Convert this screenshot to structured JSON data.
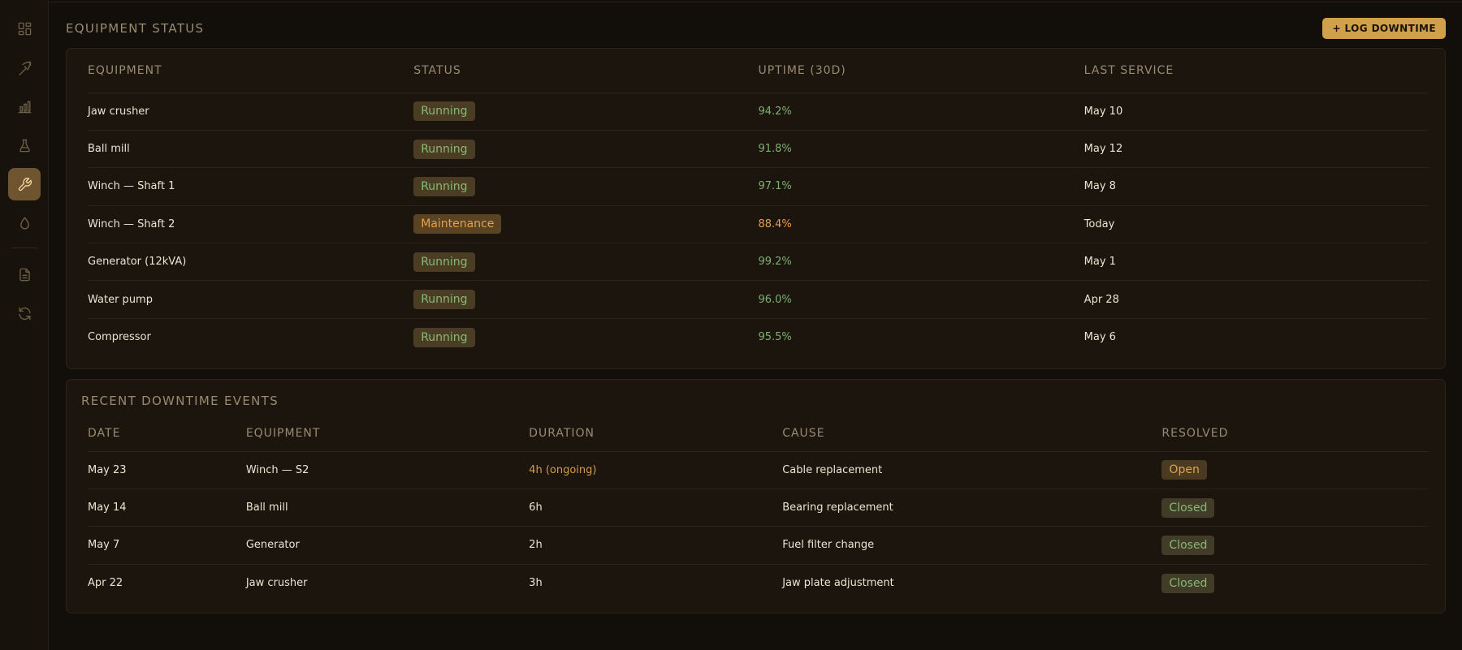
{
  "sidebar": {
    "items": [
      {
        "icon": "dashboard-icon"
      },
      {
        "icon": "pickaxe-icon"
      },
      {
        "icon": "bar-chart-icon"
      },
      {
        "icon": "flask-icon"
      },
      {
        "icon": "wrench-icon",
        "active": true
      },
      {
        "icon": "droplet-icon"
      },
      {
        "icon": "document-icon"
      },
      {
        "icon": "refresh-icon"
      }
    ]
  },
  "equipment_status": {
    "title": "EQUIPMENT STATUS",
    "log_button": "+ LOG DOWNTIME",
    "columns": [
      "EQUIPMENT",
      "STATUS",
      "UPTIME (30D)",
      "LAST SERVICE"
    ],
    "rows": [
      {
        "equipment": "Jaw crusher",
        "status": "Running",
        "uptime": "94.2%",
        "last_service": "May 10"
      },
      {
        "equipment": "Ball mill",
        "status": "Running",
        "uptime": "91.8%",
        "last_service": "May 12"
      },
      {
        "equipment": "Winch — Shaft 1",
        "status": "Running",
        "uptime": "97.1%",
        "last_service": "May 8"
      },
      {
        "equipment": "Winch — Shaft 2",
        "status": "Maintenance",
        "uptime": "88.4%",
        "last_service": "Today"
      },
      {
        "equipment": "Generator (12kVA)",
        "status": "Running",
        "uptime": "99.2%",
        "last_service": "May 1"
      },
      {
        "equipment": "Water pump",
        "status": "Running",
        "uptime": "96.0%",
        "last_service": "Apr 28"
      },
      {
        "equipment": "Compressor",
        "status": "Running",
        "uptime": "95.5%",
        "last_service": "May 6"
      }
    ]
  },
  "downtime": {
    "title": "RECENT DOWNTIME EVENTS",
    "columns": [
      "DATE",
      "EQUIPMENT",
      "DURATION",
      "CAUSE",
      "RESOLVED"
    ],
    "rows": [
      {
        "date": "May 23",
        "equipment": "Winch — S2",
        "duration": "4h (ongoing)",
        "cause": "Cable replacement",
        "resolved": "Open"
      },
      {
        "date": "May 14",
        "equipment": "Ball mill",
        "duration": "6h",
        "cause": "Bearing replacement",
        "resolved": "Closed"
      },
      {
        "date": "May 7",
        "equipment": "Generator",
        "duration": "2h",
        "cause": "Fuel filter change",
        "resolved": "Closed"
      },
      {
        "date": "Apr 22",
        "equipment": "Jaw crusher",
        "duration": "3h",
        "cause": "Jaw plate adjustment",
        "resolved": "Closed"
      }
    ]
  },
  "colors": {
    "accent": "#d0a04a",
    "running": "#86ba74",
    "maintenance": "#e3a04e",
    "background": "#120e09",
    "card": "#1b150e"
  }
}
